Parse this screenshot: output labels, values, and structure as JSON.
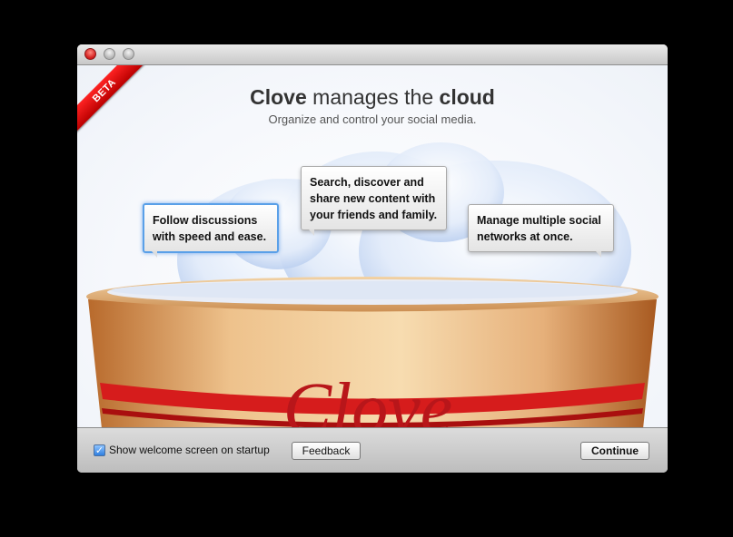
{
  "window": {
    "title": ""
  },
  "badge": {
    "label": "BETA",
    "color": "#e01010"
  },
  "header": {
    "brand": "Clove",
    "middle": " manages the ",
    "emph": "cloud",
    "subtitle": "Organize and control your social media."
  },
  "illustration": {
    "bowl_text": "Clove",
    "bowl_color": "#d9a066",
    "stripe_color": "#d61c1c"
  },
  "bubbles": [
    {
      "text_line1": "Follow discussions",
      "text_line2": "with speed and ease.",
      "selected": true
    },
    {
      "text_line1": "Search, discover and",
      "text_line2": "share new content with",
      "text_line3": "your friends and family.",
      "selected": false
    },
    {
      "text_line1": "Manage multiple social",
      "text_line2": "networks at once.",
      "selected": false
    }
  ],
  "footer": {
    "checkbox_label": "Show welcome screen on startup",
    "checkbox_checked": true,
    "feedback_label": "Feedback",
    "continue_label": "Continue"
  }
}
